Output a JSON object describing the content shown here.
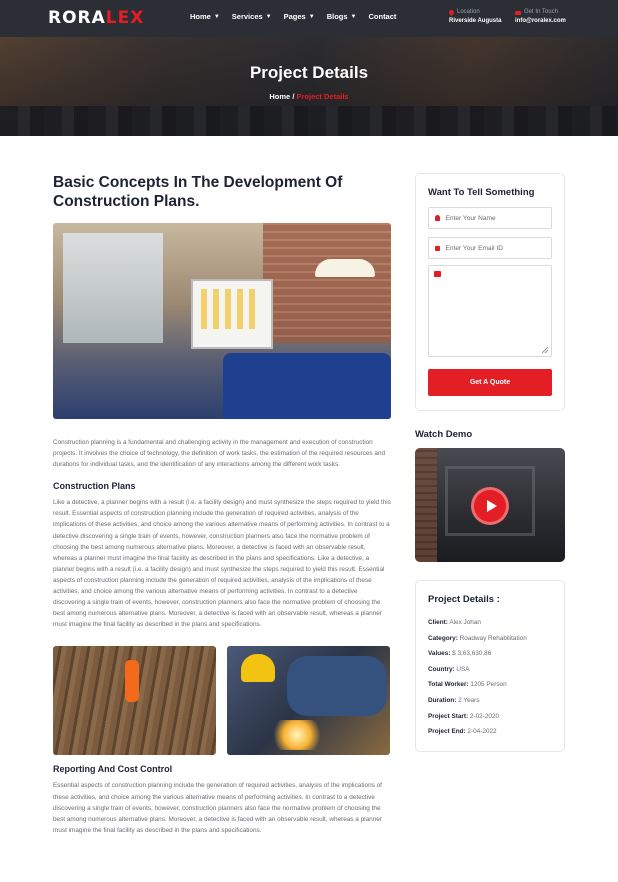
{
  "header": {
    "logo": {
      "text_main": "RORA",
      "text_accent": "LEX"
    },
    "nav": [
      {
        "label": "Home",
        "has_dropdown": true
      },
      {
        "label": "Services",
        "has_dropdown": true
      },
      {
        "label": "Pages",
        "has_dropdown": true
      },
      {
        "label": "Blogs",
        "has_dropdown": true
      },
      {
        "label": "Contact",
        "has_dropdown": false
      }
    ],
    "location": {
      "label": "Location",
      "value": "Riverside Augusta",
      "icon": "location-pin-icon"
    },
    "contact": {
      "label": "Get In Touch",
      "value": "info@roralex.com",
      "icon": "envelope-icon"
    }
  },
  "banner": {
    "title": "Project Details",
    "breadcrumb": {
      "home": "Home",
      "separator": "/",
      "current": "Project Details"
    }
  },
  "article": {
    "title": "Basic Concepts In The Development Of Construction Plans.",
    "intro": "Construction planning is a fundamental and challenging activity in the management and execution of construction projects. It involves the choice of technology, the definition of work tasks, the estimation of the required resources and durations for individual tasks, and the identification of any interactions among the different work tasks.",
    "section1_title": "Construction Plans",
    "section1_text": "Like a detective, a planner begins with a result (i.e. a facility design) and must synthesize the steps required to yield this result. Essential aspects of construction planning include the generation of required activities, analysis of the implications of these activities, and choice among the various alternative means of performing activities. In contrast to a detective discovering a single train of events, however, construction planners also face the normative problem of choosing the best among numerous alternative plans. Moreover, a detective is faced with an observable result, whereas a planner must imagine the final facility as described in the plans and specifications. Like a detective, a planner begins with a result (i.e. a facility design) and must synthesize the steps required to yield this result. Essential aspects of construction planning include the generation of required activities, analysis of the implications of these activities, and choice among the various alternative means of performing activities. In contrast to a detective discovering a single train of events, however, construction planners also face the normative problem of choosing the best among numerous alternative plans. Moreover, a detective is faced with an observable result, whereas a planner must imagine the final facility as described in the plans and specifications.",
    "section2_title": "Reporting And Cost Control",
    "section2_text": "Essential aspects of construction planning include the generation of required activities, analysis of the implications of these activities, and choice among the various alternative means of performing activities. In contrast to a detective discovering a single train of events, however, construction planners also face the normative problem of choosing the best among numerous alternative plans. Moreover, a detective is faced with an observable result, whereas a planner must imagine the final facility as described in the plans and specifications."
  },
  "sidebar": {
    "form": {
      "title": "Want To Tell Something",
      "name_placeholder": "Enter Your Name",
      "email_placeholder": "Enter Your Email ID",
      "message_placeholder": "",
      "submit_label": "Get A Quote"
    },
    "video": {
      "title": "Watch Demo"
    },
    "details": {
      "title": "Project Details :",
      "rows": [
        {
          "label": "Client:",
          "value": "Alex Johan"
        },
        {
          "label": "Category:",
          "value": "Roadway Rehabilitation"
        },
        {
          "label": "Values:",
          "value": "$ 3,63,630.86"
        },
        {
          "label": "Country:",
          "value": "USA"
        },
        {
          "label": "Total Worker:",
          "value": "1205 Person"
        },
        {
          "label": "Duration:",
          "value": "2 Years"
        },
        {
          "label": "Project Start:",
          "value": "2-02-2020"
        },
        {
          "label": "Project End:",
          "value": "2-04-2022"
        }
      ]
    }
  },
  "colors": {
    "accent": "#e31e24",
    "heading": "#1e2235",
    "body_text": "#6b6b75",
    "topbar": "#2b2f35"
  }
}
